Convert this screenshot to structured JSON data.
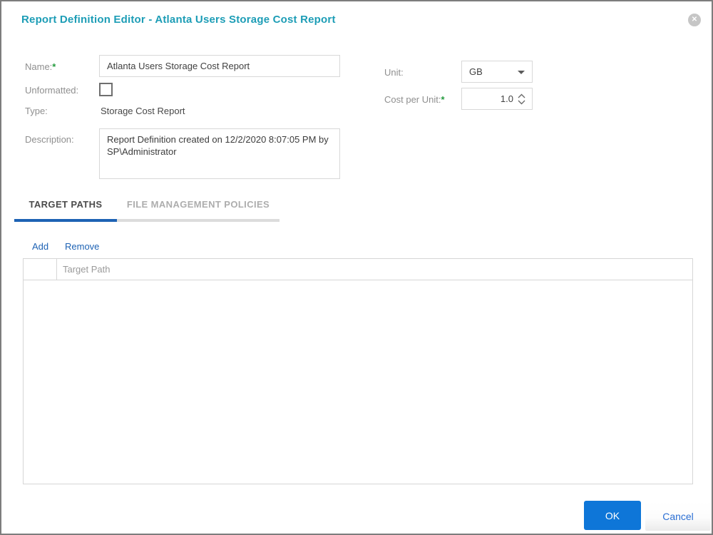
{
  "dialog": {
    "title": "Report Definition Editor - Atlanta Users Storage Cost Report",
    "close_glyph": "✕"
  },
  "form": {
    "name": {
      "label": "Name:",
      "required_mark": "*",
      "value": "Atlanta Users Storage Cost Report"
    },
    "unformatted": {
      "label": "Unformatted:",
      "checked": false
    },
    "type": {
      "label": "Type:",
      "value": "Storage Cost Report"
    },
    "description": {
      "label": "Description:",
      "value": "Report Definition created on 12/2/2020 8:07:05 PM by SP\\Administrator"
    },
    "unit": {
      "label": "Unit:",
      "value": "GB"
    },
    "cost_per_unit": {
      "label": "Cost per Unit:",
      "required_mark": "*",
      "value": "1.0"
    }
  },
  "tabs": [
    {
      "label": "TARGET PATHS",
      "active": true
    },
    {
      "label": "FILE MANAGEMENT POLICIES",
      "active": false
    }
  ],
  "target_paths": {
    "add_label": "Add",
    "remove_label": "Remove",
    "table": {
      "columns": [
        "",
        "Target Path"
      ],
      "rows": []
    }
  },
  "footer": {
    "ok_label": "OK",
    "cancel_label": "Cancel"
  },
  "colors": {
    "title_teal": "#1d9db6",
    "accent_blue": "#1d62b4",
    "ok_blue": "#0e76d8",
    "required_green": "#249b3e"
  }
}
